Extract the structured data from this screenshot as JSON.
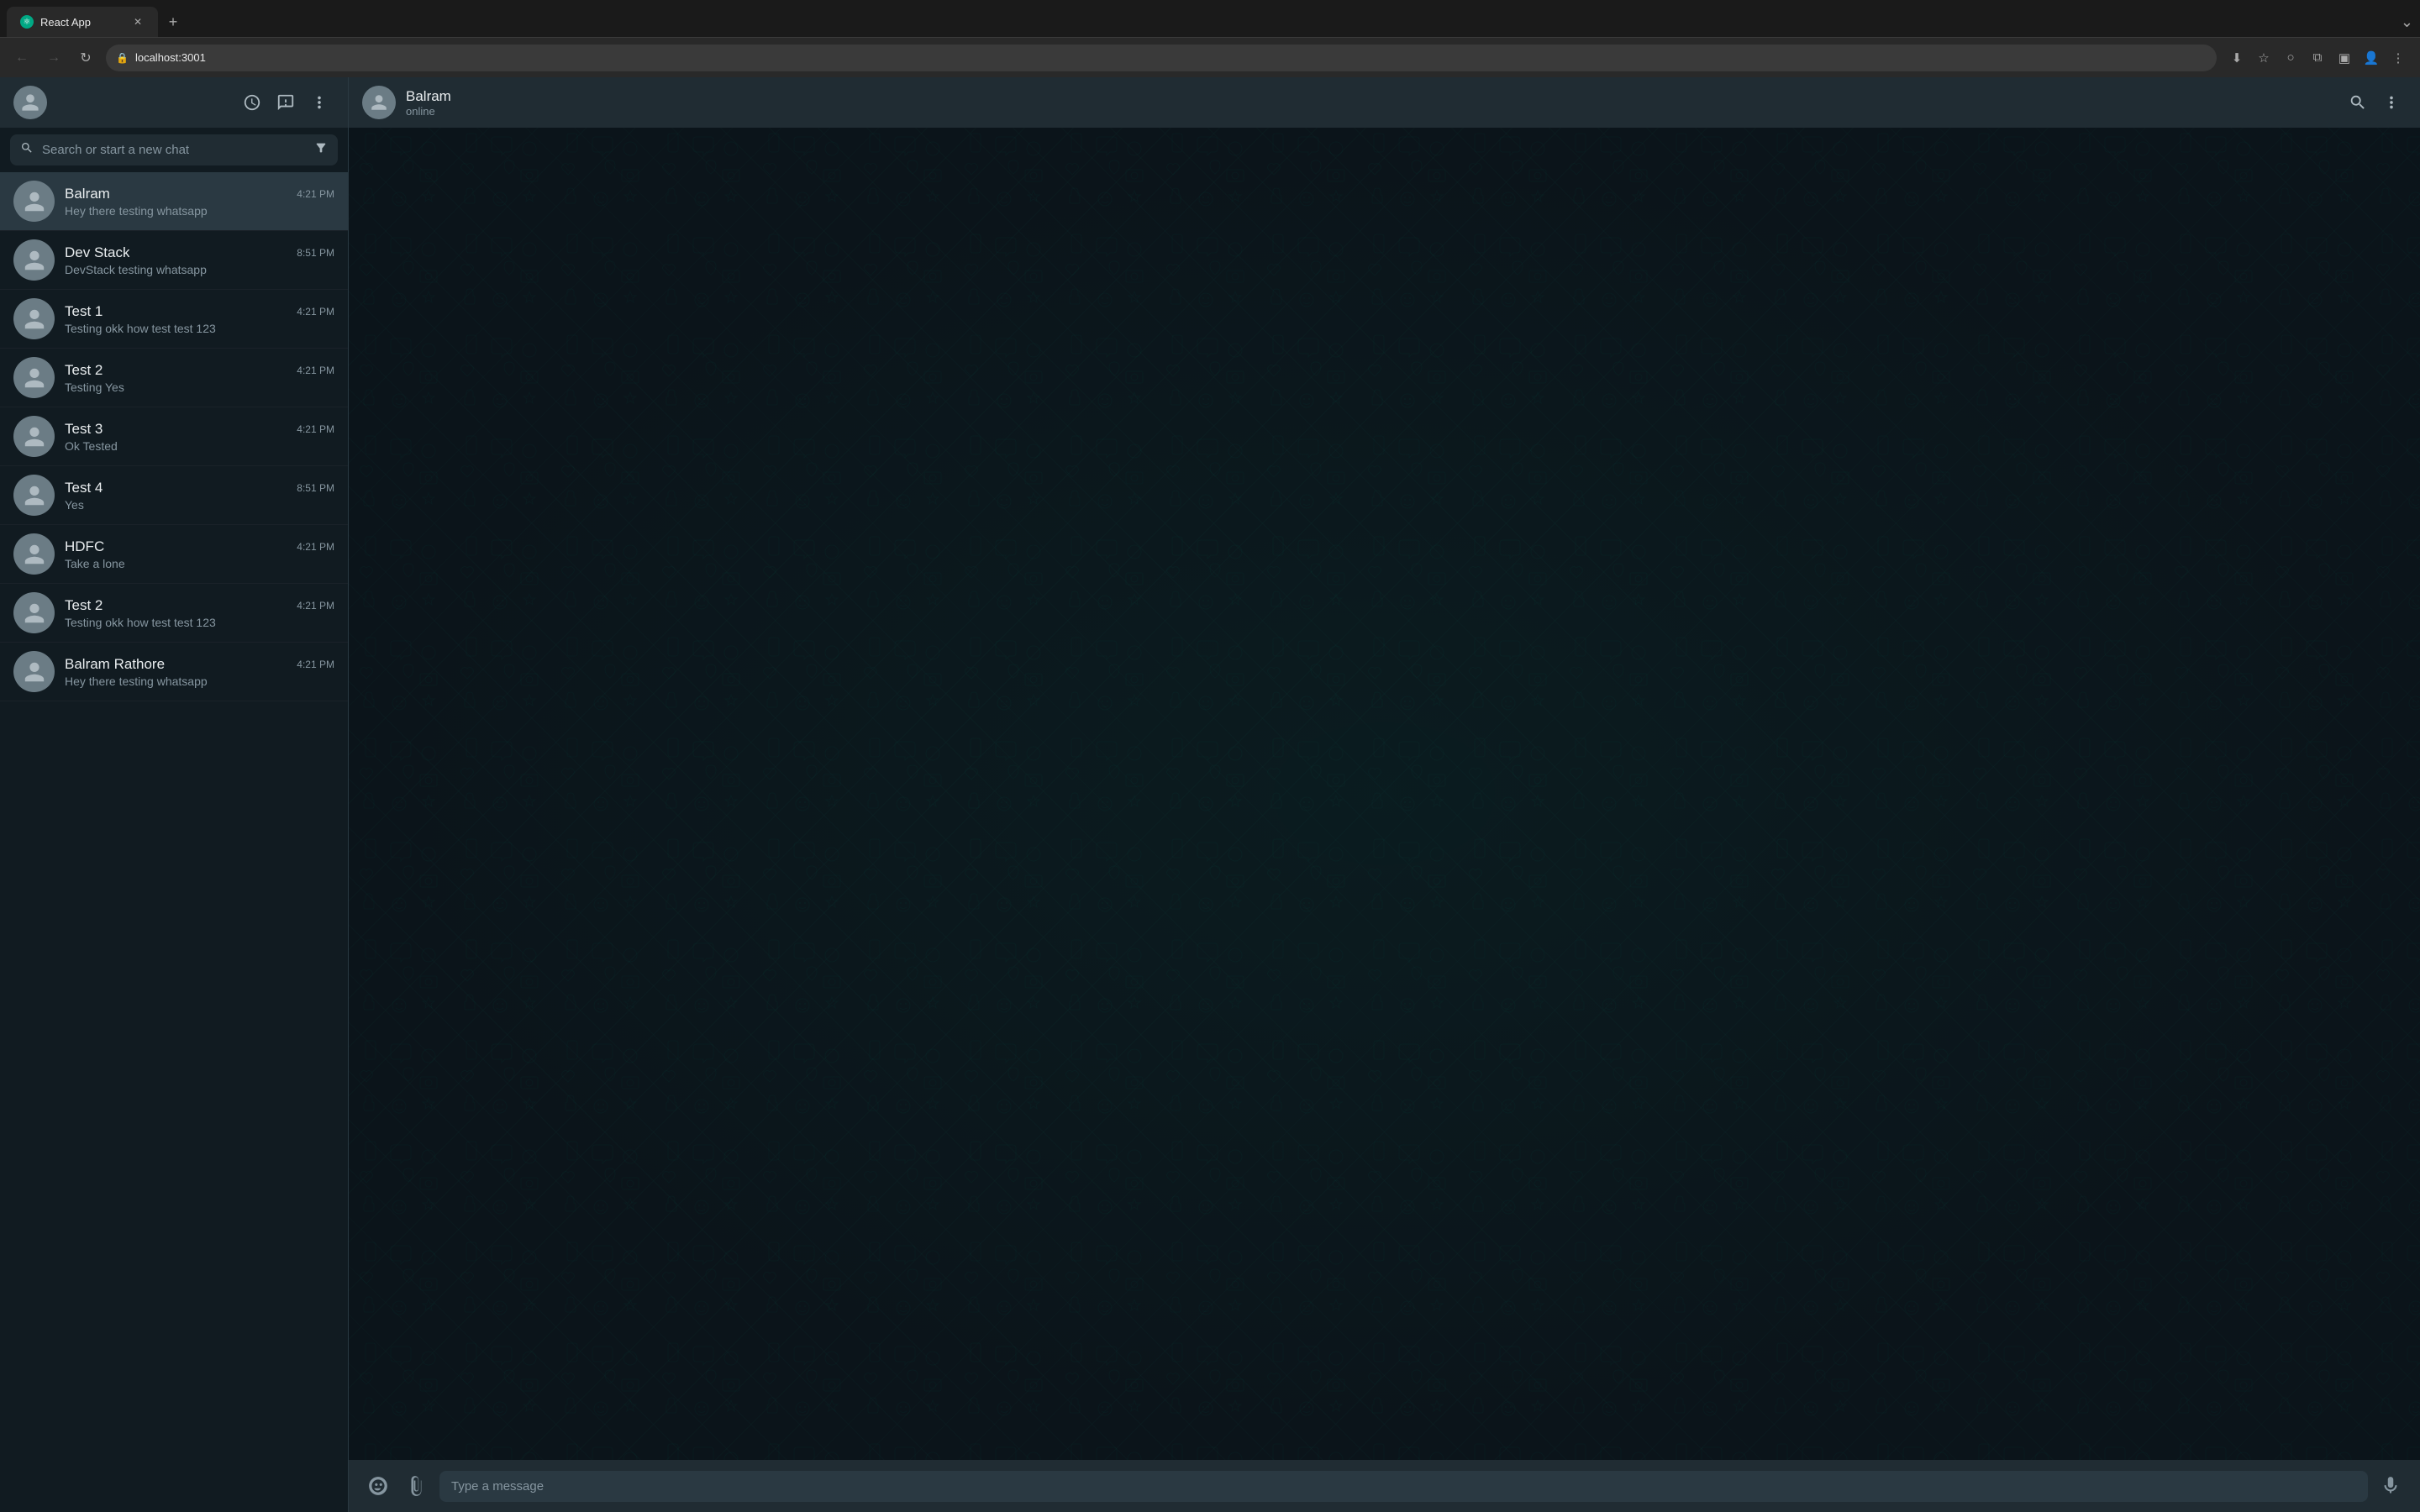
{
  "browser": {
    "tab_title": "React App",
    "tab_favicon": "⚛",
    "new_tab_label": "+",
    "tab_menu_label": "⌄",
    "url": "localhost:3001",
    "nav": {
      "back": "←",
      "forward": "→",
      "refresh": "↻",
      "lock_icon": "🔒"
    }
  },
  "sidebar": {
    "header": {
      "avatar_label": "user",
      "new_chat_label": "💬",
      "menu_label": "⋮",
      "status_label": "◎"
    },
    "search": {
      "placeholder": "Search or start a new chat",
      "filter_label": "≡"
    },
    "chats": [
      {
        "id": 1,
        "name": "Balram",
        "last_message": "Hey there testing whatsapp",
        "time": "4:21 PM",
        "active": true
      },
      {
        "id": 2,
        "name": "Dev Stack",
        "last_message": "DevStack testing whatsapp",
        "time": "8:51 PM",
        "active": false
      },
      {
        "id": 3,
        "name": "Test 1",
        "last_message": "Testing okk how test test 123",
        "time": "4:21 PM",
        "active": false
      },
      {
        "id": 4,
        "name": "Test 2",
        "last_message": "Testing Yes",
        "time": "4:21 PM",
        "active": false
      },
      {
        "id": 5,
        "name": "Test 3",
        "last_message": "Ok Tested",
        "time": "4:21 PM",
        "active": false
      },
      {
        "id": 6,
        "name": "Test 4",
        "last_message": "Yes",
        "time": "8:51 PM",
        "active": false
      },
      {
        "id": 7,
        "name": "HDFC",
        "last_message": "Take a lone",
        "time": "4:21 PM",
        "active": false
      },
      {
        "id": 8,
        "name": "Test 2",
        "last_message": "Testing okk how test test 123",
        "time": "4:21 PM",
        "active": false
      },
      {
        "id": 9,
        "name": "Balram Rathore",
        "last_message": "Hey there testing whatsapp",
        "time": "4:21 PM",
        "active": false
      }
    ]
  },
  "chat": {
    "contact_name": "Balram",
    "contact_status": "online",
    "search_label": "🔍",
    "menu_label": "⋮",
    "message_placeholder": "Type a message",
    "emoji_label": "😊",
    "attach_label": "📎",
    "mic_label": "🎙"
  },
  "colors": {
    "active_bg": "#2a3942",
    "sidebar_bg": "#111b21",
    "header_bg": "#202c33",
    "chat_bg": "#0b141a",
    "accent": "#00a884",
    "text_primary": "#e9edef",
    "text_secondary": "#8696a0",
    "avatar_bg": "#6b7c85"
  }
}
